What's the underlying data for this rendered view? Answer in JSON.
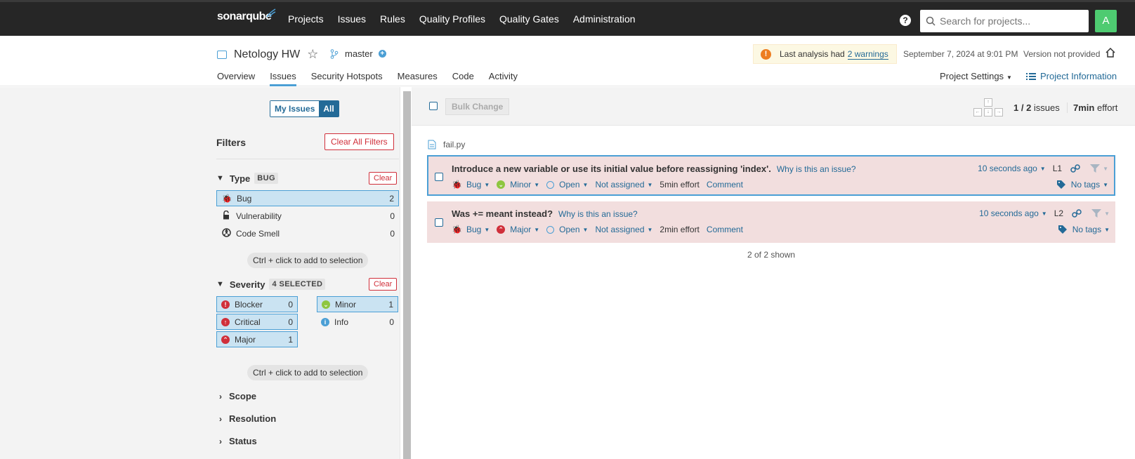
{
  "app": {
    "logo": "sonarqube",
    "nav": [
      "Projects",
      "Issues",
      "Rules",
      "Quality Profiles",
      "Quality Gates",
      "Administration"
    ],
    "search_placeholder": "Search for projects...",
    "avatar": "A",
    "help": "?"
  },
  "project": {
    "name": "Netology HW",
    "branch": "master",
    "warning_text": "Last analysis had",
    "warning_link": "2 warnings",
    "analysis_date": "September 7, 2024 at 9:01 PM",
    "version": "Version not provided",
    "tabs": [
      "Overview",
      "Issues",
      "Security Hotspots",
      "Measures",
      "Code",
      "Activity"
    ],
    "active_tab": "Issues",
    "settings": "Project Settings",
    "info": "Project Information"
  },
  "sidebar": {
    "my_issues": "My Issues",
    "all": "All",
    "filters_title": "Filters",
    "clear_all": "Clear All Filters",
    "clear": "Clear",
    "type": {
      "label": "Type",
      "badge": "BUG",
      "items": [
        {
          "label": "Bug",
          "count": "2",
          "icon": "bug-icon"
        },
        {
          "label": "Vulnerability",
          "count": "0",
          "icon": "lock-icon"
        },
        {
          "label": "Code Smell",
          "count": "0",
          "icon": "code-smell-icon"
        }
      ]
    },
    "hint": "Ctrl + click to add to selection",
    "severity": {
      "label": "Severity",
      "badge": "4 SELECTED",
      "items": [
        {
          "label": "Blocker",
          "count": "0",
          "color": "#d02f3a"
        },
        {
          "label": "Minor",
          "count": "1",
          "color": "#8ec640"
        },
        {
          "label": "Critical",
          "count": "0",
          "color": "#d02f3a"
        },
        {
          "label": "Info",
          "count": "0",
          "color": "#4b9fd5"
        },
        {
          "label": "Major",
          "count": "1",
          "color": "#d02f3a"
        }
      ]
    },
    "collapsed": [
      "Scope",
      "Resolution",
      "Status"
    ]
  },
  "main": {
    "bulk_change": "Bulk Change",
    "count": "1 / 2",
    "count_suffix": "issues",
    "effort": "7min",
    "effort_suffix": "effort",
    "file": "fail.py",
    "shown": "2 of 2 shown",
    "issues": [
      {
        "message": "Introduce a new variable or use its initial value before reassigning 'index'.",
        "why": "Why is this an issue?",
        "type": "Bug",
        "severity": "Minor",
        "status": "Open",
        "assignee": "Not assigned",
        "effort": "5min effort",
        "comment": "Comment",
        "age": "10 seconds ago",
        "line": "L1",
        "tags": "No tags"
      },
      {
        "message": "Was += meant instead?",
        "why": "Why is this an issue?",
        "type": "Bug",
        "severity": "Major",
        "status": "Open",
        "assignee": "Not assigned",
        "effort": "2min effort",
        "comment": "Comment",
        "age": "10 seconds ago",
        "line": "L2",
        "tags": "No tags"
      }
    ]
  }
}
